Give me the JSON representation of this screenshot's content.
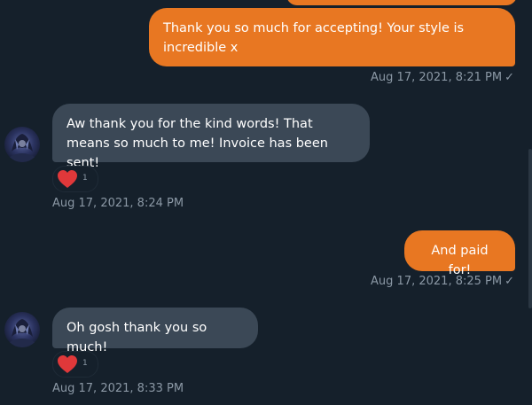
{
  "colors": {
    "background": "#15202b",
    "sent_bubble": "#e87722",
    "received_bubble": "#3b4856",
    "timestamp_text": "#8b98a5",
    "heart": "#e0383a"
  },
  "messages": [
    {
      "direction": "sent",
      "text": "Thank you so much for accepting! Your style is incredible x",
      "timestamp": "Aug 17, 2021, 8:21 PM",
      "read_check": "✓"
    },
    {
      "direction": "received",
      "text": "Aw thank you for the kind words! That means so much to me! Invoice has been sent!",
      "reaction": {
        "icon": "heart-icon",
        "count": "1"
      },
      "timestamp": "Aug 17, 2021, 8:24 PM"
    },
    {
      "direction": "sent",
      "text": "And paid for!",
      "timestamp": "Aug 17, 2021, 8:25 PM",
      "read_check": "✓"
    },
    {
      "direction": "received",
      "text": "Oh gosh thank you so much!",
      "reaction": {
        "icon": "heart-icon",
        "count": "1"
      },
      "timestamp": "Aug 17, 2021, 8:33 PM"
    }
  ]
}
